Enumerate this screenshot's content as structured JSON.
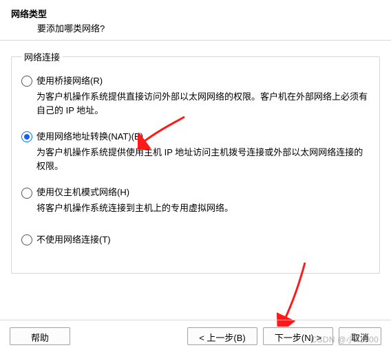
{
  "header": {
    "title": "网络类型",
    "subtitle": "要添加哪类网络?"
  },
  "group": {
    "legend": "网络连接"
  },
  "options": [
    {
      "label": "使用桥接网络(R)",
      "desc": "为客户机操作系统提供直接访问外部以太网网络的权限。客户机在外部网络上必须有自己的 IP 地址。",
      "checked": false
    },
    {
      "label": "使用网络地址转换(NAT)(E)",
      "desc": "为客户机操作系统提供使用主机 IP 地址访问主机拨号连接或外部以太网网络连接的权限。",
      "checked": true
    },
    {
      "label": "使用仅主机模式网络(H)",
      "desc": "将客户机操作系统连接到主机上的专用虚拟网络。",
      "checked": false
    },
    {
      "label": "不使用网络连接(T)",
      "desc": "",
      "checked": false
    }
  ],
  "buttons": {
    "help": "帮助",
    "back": "< 上一步(B)",
    "next": "下一步(N) >",
    "cancel": "取消"
  },
  "watermark": "CSDN @小41500",
  "annotations": {
    "arrow_color": "#ff1a1a"
  }
}
